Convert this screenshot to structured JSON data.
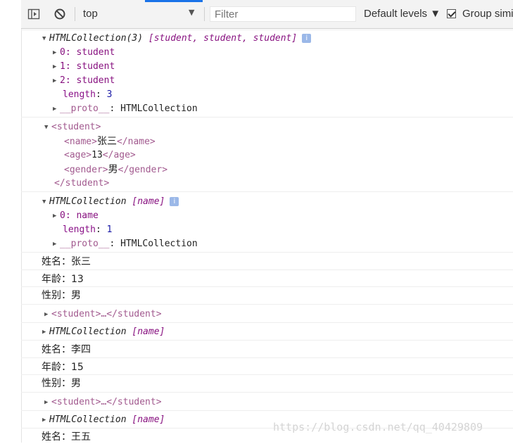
{
  "toolbar": {
    "context": "top",
    "filter_placeholder": "Filter",
    "levels": "Default levels ▼",
    "group_label": "Group simi"
  },
  "log1": {
    "header_italic": "HTMLCollection(3) ",
    "header_items": "[student, student, student]",
    "items": [
      "0: student",
      "1: student",
      "2: student"
    ],
    "length_key": "length",
    "length_value": "3",
    "proto_key": "__proto__",
    "proto_value": "HTMLCollection"
  },
  "log2": {
    "open_tag": "<student>",
    "name_open": "<name>",
    "name_value": "张三",
    "name_close": "</name>",
    "age_open": "<age>",
    "age_value": "13",
    "age_close": "</age>",
    "gender_open": "<gender>",
    "gender_value": "男",
    "gender_close": "</gender>",
    "close_tag": "</student>"
  },
  "log3": {
    "header_italic": "HTMLCollection ",
    "header_items": "[name]",
    "items": [
      "0: name"
    ],
    "length_key": "length",
    "length_value": "1",
    "proto_key": "__proto__",
    "proto_value": "HTMLCollection"
  },
  "plain": {
    "l1": "姓名：张三",
    "l2": "年龄：13",
    "l3": "性别：男",
    "l4": "姓名：李四",
    "l5": "年龄：15",
    "l6": "性别：男",
    "l7": "姓名：王五"
  },
  "collapsed_student": "<student>…</student>",
  "collapsed_collection": {
    "italic": "HTMLCollection ",
    "items": "[name]"
  },
  "watermark": "https://blog.csdn.net/qq_40429809"
}
